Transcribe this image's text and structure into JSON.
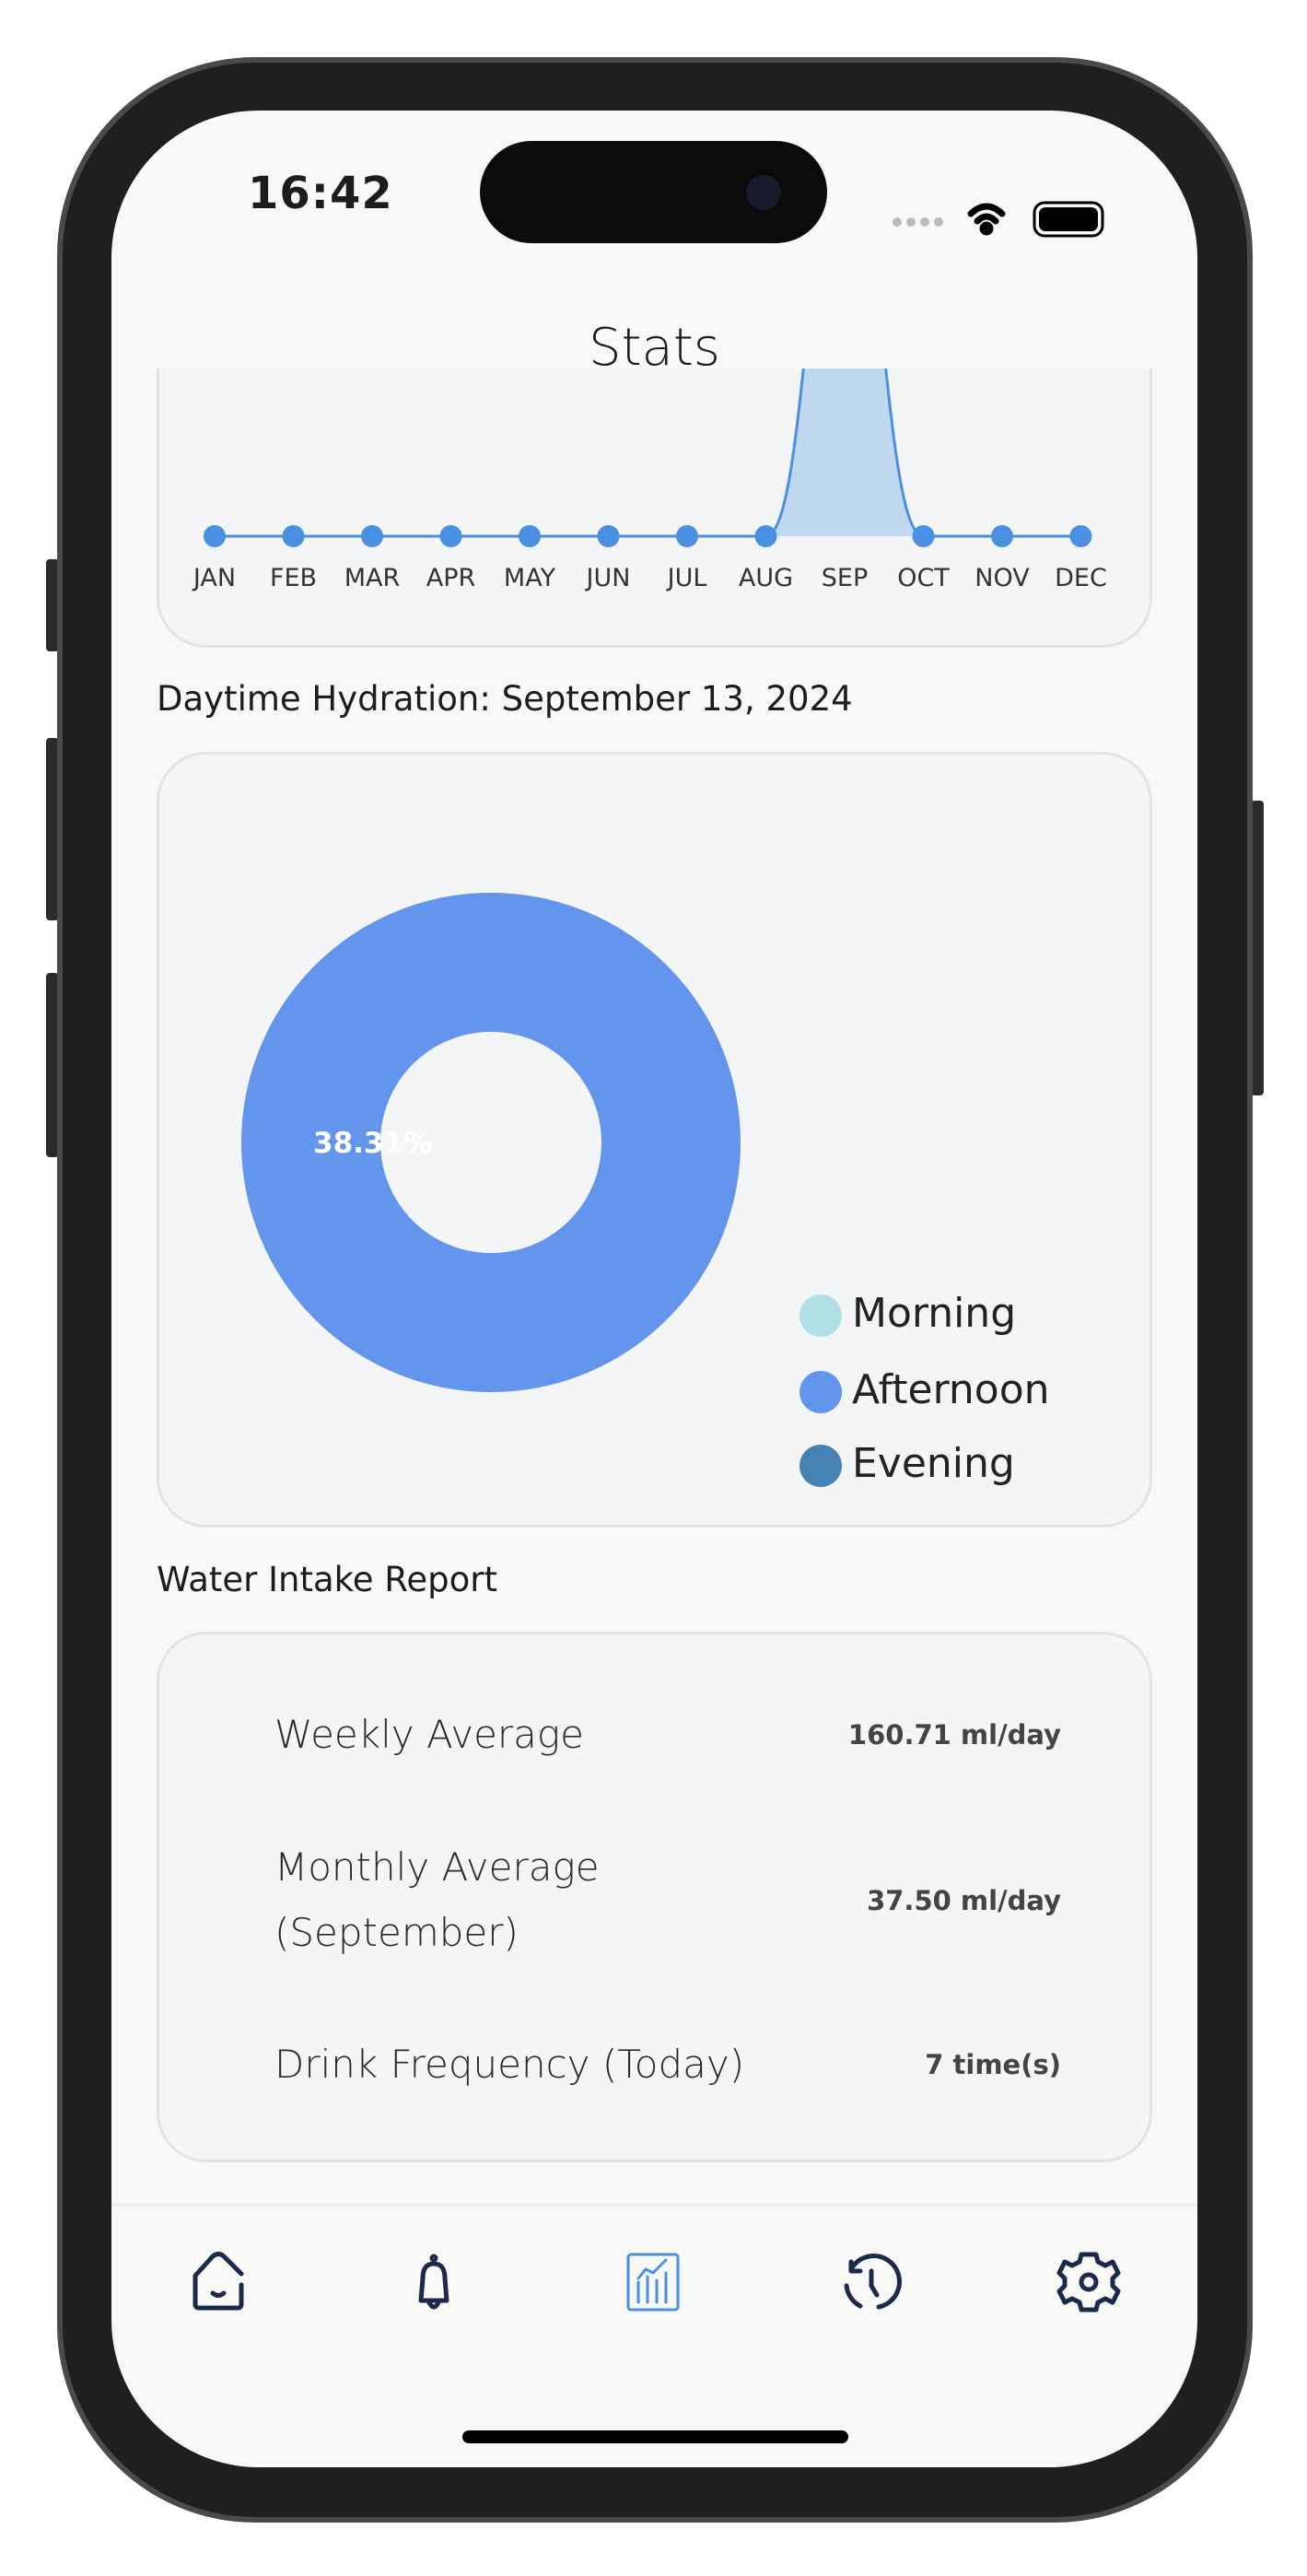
{
  "status_bar": {
    "time": "16:42"
  },
  "header": {
    "title": "Stats"
  },
  "chart_data": [
    {
      "type": "area",
      "categories": [
        "JAN",
        "FEB",
        "MAR",
        "APR",
        "MAY",
        "JUN",
        "JUL",
        "AUG",
        "SEP",
        "OCT",
        "NOV",
        "DEC"
      ],
      "values": [
        0,
        0,
        0,
        0,
        0,
        0,
        0,
        0,
        1,
        0,
        0,
        0
      ],
      "color": "#4a90e2",
      "fill": "#c0d7f0"
    },
    {
      "type": "pie",
      "title": "Daytime Hydration: September 13, 2024",
      "labels": [
        "Morning",
        "Afternoon",
        "Evening"
      ],
      "colors": [
        "#b0e0e6",
        "#6495ed",
        "#4682b4"
      ],
      "values": [
        0,
        100,
        0
      ],
      "data_label": "38.31%",
      "legend": "bottom-right"
    }
  ],
  "report": {
    "title": "Water Intake Report",
    "rows": [
      {
        "label": "Weekly Average",
        "value": "160.71 ml/day"
      },
      {
        "label_line1": "Monthly Average",
        "label_line2": "(September)",
        "value": "37.50 ml/day"
      },
      {
        "label": "Drink Frequency (Today)",
        "value": "7 time(s)"
      }
    ]
  },
  "tabs": [
    {
      "icon": "home-icon"
    },
    {
      "icon": "bell-icon"
    },
    {
      "icon": "chart-icon",
      "active": true
    },
    {
      "icon": "history-icon"
    },
    {
      "icon": "settings-icon"
    }
  ],
  "colors": {
    "accent": "#4a90e2",
    "nav": "#1b2a4a"
  }
}
